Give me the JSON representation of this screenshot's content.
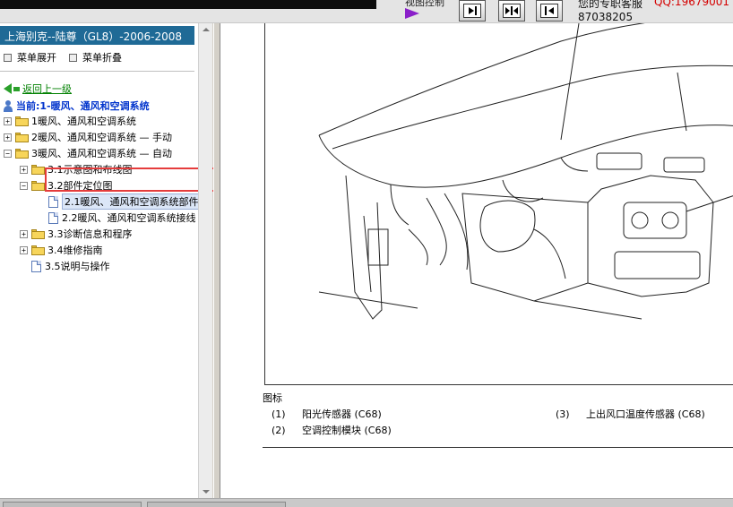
{
  "topbar": {
    "view_control_label": "视图控制",
    "service_text": "您的专职客服",
    "qq_text": "QQ:19679001",
    "phone_text": "87038205"
  },
  "sidebar": {
    "title": "上海别克--陆尊（GL8）-2006-2008",
    "expand_label": "菜单展开",
    "collapse_label": "菜单折叠",
    "back_label": "返回上一级",
    "current_label": "当前:1-暖风、通风和空调系统",
    "tree": [
      {
        "label": "1暖风、通风和空调系统",
        "toggle": "+"
      },
      {
        "label": "2暖风、通风和空调系统 — 手动",
        "toggle": "+"
      },
      {
        "label": "3暖风、通风和空调系统 — 自动",
        "toggle": "−"
      },
      {
        "label": "3.1示意图和布线图",
        "toggle": "+"
      },
      {
        "label": "3.2部件定位图",
        "toggle": "−"
      },
      {
        "label": "2.1暖风、通风和空调系统部件"
      },
      {
        "label": "2.2暖风、通风和空调系统接线"
      },
      {
        "label": "3.3诊断信息和程序",
        "toggle": "+"
      },
      {
        "label": "3.4维修指南",
        "toggle": "+"
      },
      {
        "label": "3.5说明与操作"
      }
    ]
  },
  "content": {
    "legend_title": "图标",
    "legend": [
      {
        "num": "(1)",
        "label": "阳光传感器 (C68)"
      },
      {
        "num": "(2)",
        "label": "空调控制模块 (C68)"
      },
      {
        "num": "(3)",
        "label": "上出风口温度传感器 (C68)"
      }
    ]
  }
}
